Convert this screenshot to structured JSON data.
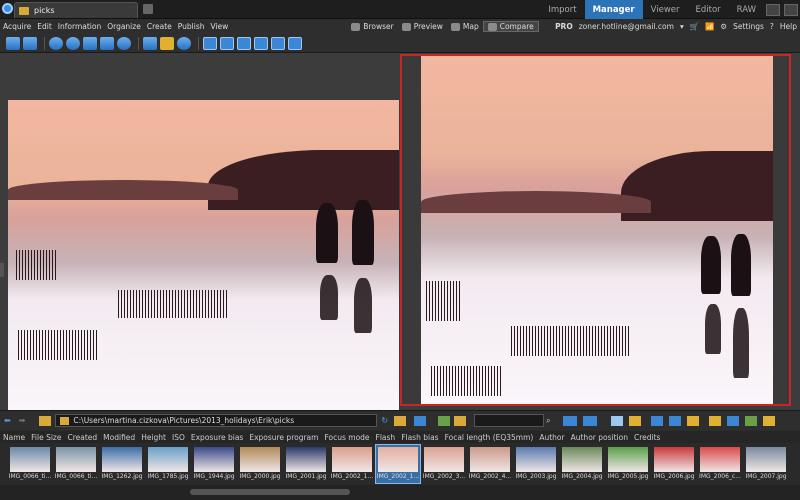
{
  "app": {
    "tab_title": "picks"
  },
  "modes": [
    {
      "label": "Import",
      "active": false
    },
    {
      "label": "Manager",
      "active": true
    },
    {
      "label": "Viewer",
      "active": false
    },
    {
      "label": "Editor",
      "active": false
    },
    {
      "label": "RAW",
      "active": false
    }
  ],
  "menu": [
    "Acquire",
    "Edit",
    "Information",
    "Organize",
    "Create",
    "Publish",
    "View"
  ],
  "view_buttons": [
    "Browser",
    "Preview",
    "Map",
    "Compare"
  ],
  "account": {
    "edition": "PRO",
    "email": "zoner.hotline@gmail.com",
    "settings": "Settings",
    "help": "Help"
  },
  "nav": {
    "path": "C:\\Users\\martina.cizkova\\Pictures\\2013_holidays\\Erik\\picks"
  },
  "columns": [
    "Name",
    "File Size",
    "Created",
    "Modified",
    "Height",
    "ISO",
    "Exposure bias",
    "Exposure program",
    "Focus mode",
    "Flash",
    "Flash bias",
    "Focal length (EQ35mm)",
    "Author",
    "Author position",
    "Credits"
  ],
  "thumbnails": [
    {
      "label": "IMG_0066_ti...",
      "color": "#6a8aa8",
      "selected": false
    },
    {
      "label": "IMG_0066_ti...",
      "color": "#7a94a6",
      "selected": false
    },
    {
      "label": "IMG_1262.jpg",
      "color": "#3c6ea8",
      "selected": false
    },
    {
      "label": "IMG_1785.jpg",
      "color": "#6aa0c8",
      "selected": false
    },
    {
      "label": "IMG_1944.jpg",
      "color": "#3a4a8a",
      "selected": false
    },
    {
      "label": "IMG_2000.jpg",
      "color": "#b08a5a",
      "selected": false
    },
    {
      "label": "IMG_2001.jpg",
      "color": "#2a3a6a",
      "selected": false
    },
    {
      "label": "IMG_2002_1...",
      "color": "#d9a08a",
      "selected": false
    },
    {
      "label": "IMG_2002_1...",
      "color": "#e2b0a0",
      "selected": true
    },
    {
      "label": "IMG_2002_3...",
      "color": "#d8a292",
      "selected": false
    },
    {
      "label": "IMG_2002_4...",
      "color": "#c99a8a",
      "selected": false
    },
    {
      "label": "IMG_2003.jpg",
      "color": "#5a7ab0",
      "selected": false
    },
    {
      "label": "IMG_2004.jpg",
      "color": "#6a8a5a",
      "selected": false
    },
    {
      "label": "IMG_2005.jpg",
      "color": "#5aa04a",
      "selected": false
    },
    {
      "label": "IMG_2006.jpg",
      "color": "#c83a3a",
      "selected": false
    },
    {
      "label": "IMG_2006_c...",
      "color": "#d84a4a",
      "selected": false
    },
    {
      "label": "IMG_2007.jpg",
      "color": "#7a8aa0",
      "selected": false
    }
  ],
  "colors": {
    "accent": "#2c74b8",
    "compare_border": "#c62828"
  }
}
